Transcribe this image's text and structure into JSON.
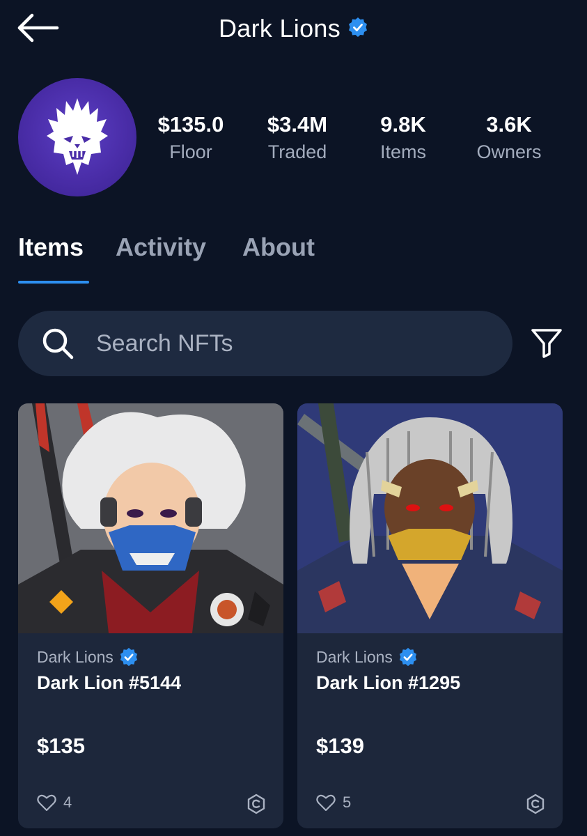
{
  "header": {
    "title": "Dark Lions"
  },
  "stats": [
    {
      "value": "$135.0",
      "label": "Floor"
    },
    {
      "value": "$3.4M",
      "label": "Traded"
    },
    {
      "value": "9.8K",
      "label": "Items"
    },
    {
      "value": "3.6K",
      "label": "Owners"
    }
  ],
  "tabs": [
    {
      "label": "Items",
      "active": true
    },
    {
      "label": "Activity",
      "active": false
    },
    {
      "label": "About",
      "active": false
    }
  ],
  "search": {
    "placeholder": "Search NFTs",
    "value": ""
  },
  "cards": [
    {
      "collection": "Dark Lions",
      "name": "Dark Lion #5144",
      "price": "$135",
      "likes": "4"
    },
    {
      "collection": "Dark Lions",
      "name": "Dark Lion #1295",
      "price": "$139",
      "likes": "5"
    }
  ],
  "icons": {
    "back": "arrow-left-icon",
    "verified": "verified-badge-icon",
    "search": "search-icon",
    "filter": "filter-icon",
    "like": "heart-icon",
    "chain": "chain-logo-icon"
  },
  "colors": {
    "background": "#0c1425",
    "surface": "#1e2a40",
    "accent": "#2d8ff0",
    "avatar": "#4a2da8"
  }
}
